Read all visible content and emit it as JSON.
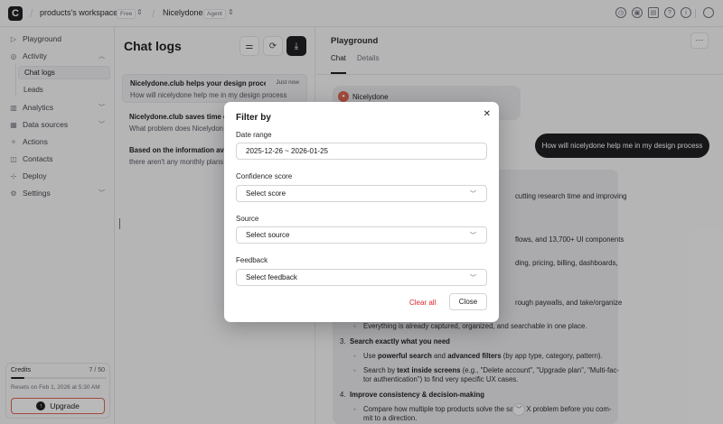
{
  "topbar": {
    "logo": "C",
    "workspace": "products's workspace",
    "workspace_badge": "Free",
    "agent": "Nicelydone",
    "agent_badge": "Agent"
  },
  "sidebar": {
    "items": [
      {
        "label": "Playground",
        "icon": "play-icon"
      },
      {
        "label": "Activity",
        "icon": "activity-icon"
      },
      {
        "label": "Analytics",
        "icon": "analytics-icon"
      },
      {
        "label": "Data sources",
        "icon": "data-sources-icon"
      },
      {
        "label": "Actions",
        "icon": "actions-icon"
      },
      {
        "label": "Contacts",
        "icon": "contacts-icon"
      },
      {
        "label": "Deploy",
        "icon": "deploy-icon"
      },
      {
        "label": "Settings",
        "icon": "settings-icon"
      }
    ],
    "sub_items": [
      "Chat logs",
      "Leads"
    ],
    "credits_label": "Credits",
    "credits_value": "7 / 50",
    "credits_fraction": 0.14,
    "resets": "Resets on Feb 1, 2026 at 5:30 AM",
    "upgrade": "Upgrade"
  },
  "chat_logs": {
    "title": "Chat logs",
    "items": [
      {
        "title": "Nicelydone.club helps your design proce...",
        "subtitle": "How will nicelydone help me in my design process",
        "time": "Just now"
      },
      {
        "title": "Nicelydone.club saves time d",
        "subtitle": "What problem does Nicelydon",
        "time": ""
      },
      {
        "title": "Based on the information ava",
        "subtitle": "there aren't any monthly plans",
        "time": ""
      }
    ]
  },
  "playground": {
    "title": "Playground",
    "tabs": [
      "Chat",
      "Details"
    ],
    "bot_name": "Nicelydone",
    "user_message": "How will nicelydone help me in my design process",
    "answer": {
      "l1": "cutting research time and improving",
      "l2": "flows, and 13,700+ UI components",
      "l3": "ding, pricing, billing, dashboards,",
      "l4": "rough paywalls, and take/organize",
      "l5": "Everything is already captured, organized, and searchable in one place.",
      "h3_num": "3.",
      "h3": "Search exactly what you need",
      "s3a_pre": "Use ",
      "s3a_b1": "powerful search",
      "s3a_mid": " and ",
      "s3a_b2": "advanced filters",
      "s3a_post": " (by app type, category, pattern).",
      "s3b_pre": "Search by ",
      "s3b_b": "text inside screens",
      "s3b_post": " (e.g., \"Delete account\", \"Upgrade plan\", \"Multi-fac-",
      "s3b_l2": "tor authentication\") to find very specific UX cases.",
      "h4_num": "4.",
      "h4": "Improve consistency & decision-making",
      "s4a_pre": "Compare how multiple top products solve the sa",
      "s4a_post": "X problem before you com-",
      "s4a_l2": "mit to a direction."
    }
  },
  "modal": {
    "title": "Filter by",
    "date_label": "Date range",
    "date_value": "2025-12-26 ~ 2026-01-25",
    "confidence_label": "Confidence score",
    "confidence_value": "Select score",
    "source_label": "Source",
    "source_value": "Select source",
    "feedback_label": "Feedback",
    "feedback_value": "Select feedback",
    "clear_all": "Clear all",
    "close": "Close"
  }
}
